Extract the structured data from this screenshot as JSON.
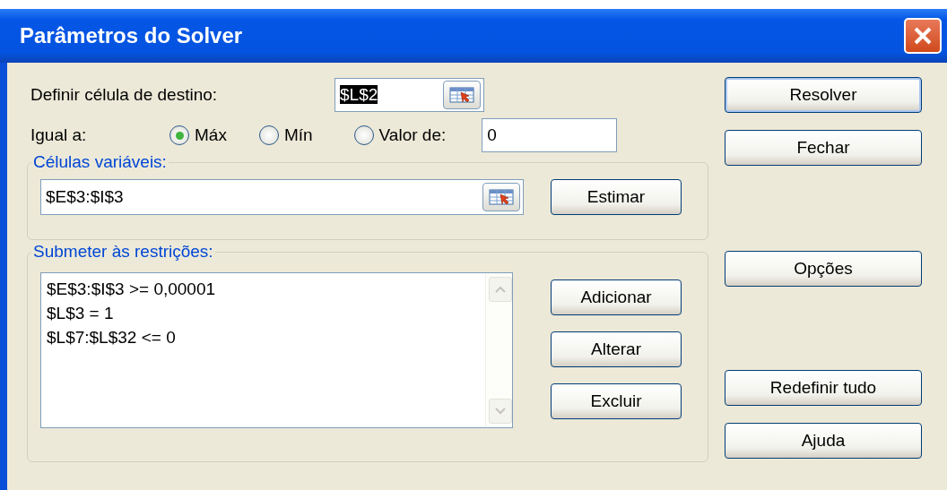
{
  "window": {
    "title": "Parâmetros do Solver"
  },
  "target": {
    "label": "Definir célula de destino:",
    "value": "$L$2",
    "highlighted": true
  },
  "equal_to": {
    "label": "Igual a:",
    "options": [
      {
        "label": "Máx",
        "selected": true
      },
      {
        "label": "Mín",
        "selected": false
      },
      {
        "label": "Valor de:",
        "selected": false
      }
    ],
    "value": "0"
  },
  "variable_cells": {
    "legend": "Células variáveis:",
    "value": "$E$3:$I$3",
    "button": "Estimar"
  },
  "constraints": {
    "legend": "Submeter às restrições:",
    "items": [
      "$E$3:$I$3 >= 0,00001",
      "$L$3 = 1",
      "$L$7:$L$32 <= 0"
    ],
    "buttons": [
      "Adicionar",
      "Alterar",
      "Excluir"
    ]
  },
  "side_buttons": [
    {
      "label": "Resolver",
      "default": true
    },
    {
      "label": "Fechar",
      "default": false
    },
    {
      "label": "Opções",
      "default": false
    },
    {
      "label": "Redefinir tudo",
      "default": false
    },
    {
      "label": "Ajuda",
      "default": false
    }
  ]
}
